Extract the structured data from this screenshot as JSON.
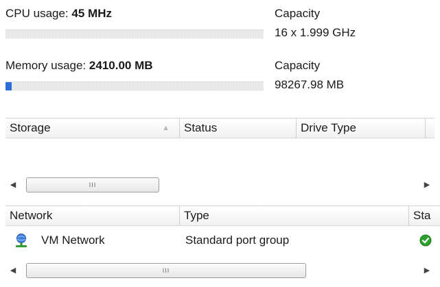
{
  "cpu": {
    "label": "CPU usage:",
    "value": "45 MHz",
    "usage_fraction": 0.0,
    "capacity_label": "Capacity",
    "capacity_value": "16 x 1.999 GHz"
  },
  "memory": {
    "label": "Memory usage:",
    "value": "2410.00 MB",
    "usage_fraction": 0.025,
    "capacity_label": "Capacity",
    "capacity_value": "98267.98 MB"
  },
  "storage_table": {
    "columns": [
      "Storage",
      "Status",
      "Drive Type"
    ],
    "sort_column": "Storage",
    "rows": []
  },
  "network_table": {
    "columns": [
      "Network",
      "Type",
      "Sta"
    ],
    "rows": [
      {
        "network": "VM Network",
        "type": "Standard port group",
        "status_icon": "green-check-icon"
      }
    ]
  },
  "scrollbar": {
    "thumb_glyph": "III",
    "left_arrow": "◀",
    "right_arrow": "▶"
  },
  "colors": {
    "usage_fill": "#2b6fd6",
    "status_ok": "#2ea02e"
  }
}
